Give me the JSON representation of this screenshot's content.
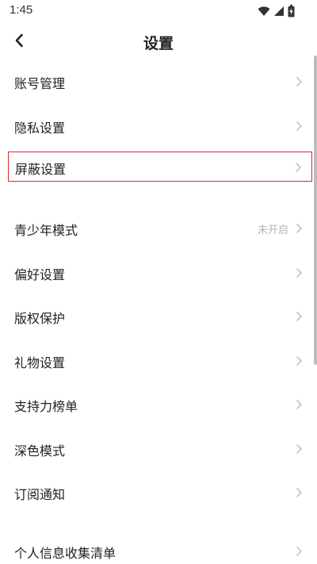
{
  "status_bar": {
    "time": "1:45"
  },
  "nav": {
    "title": "设置",
    "back_icon": "chevron-left-icon"
  },
  "settings_items": [
    {
      "label": "账号管理",
      "value": ""
    },
    {
      "label": "隐私设置",
      "value": ""
    },
    {
      "label": "屏蔽设置",
      "value": "",
      "highlighted": true
    },
    {
      "label": "青少年模式",
      "value": "未开启"
    },
    {
      "label": "偏好设置",
      "value": ""
    },
    {
      "label": "版权保护",
      "value": ""
    },
    {
      "label": "礼物设置",
      "value": ""
    },
    {
      "label": "支持力榜单",
      "value": ""
    },
    {
      "label": "深色模式",
      "value": ""
    },
    {
      "label": "订阅通知",
      "value": ""
    },
    {
      "label": "个人信息收集清单",
      "value": ""
    }
  ],
  "colors": {
    "highlight_border": "#d9252c",
    "chevron": "#c4c4c4",
    "value_text": "#b5b5b5"
  }
}
